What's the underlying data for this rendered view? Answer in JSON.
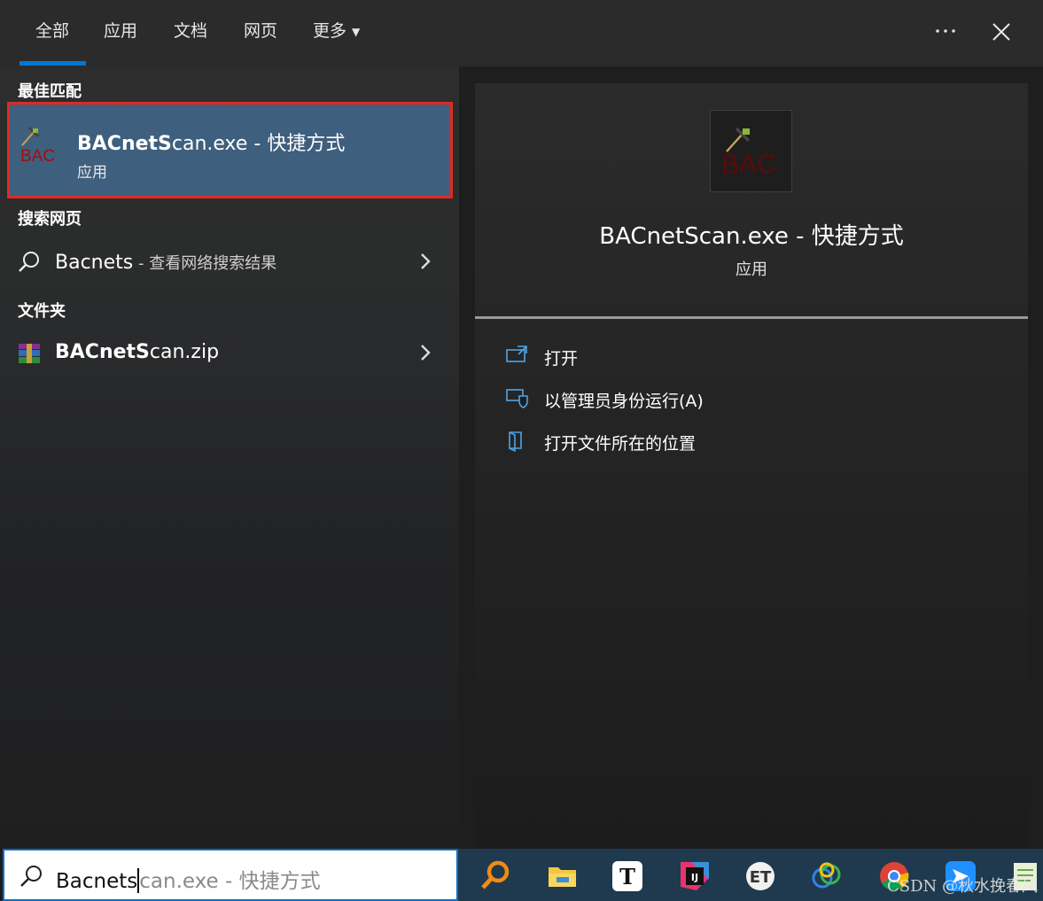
{
  "tabs": [
    {
      "label": "全部",
      "active": true
    },
    {
      "label": "应用"
    },
    {
      "label": "文档"
    },
    {
      "label": "网页"
    },
    {
      "label": "更多"
    }
  ],
  "sections": {
    "best_match": "最佳匹配",
    "search_web": "搜索网页",
    "folders": "文件夹"
  },
  "best_match": {
    "title_bold": "BACnetS",
    "title_rest": "can.exe - 快捷方式",
    "subtitle": "应用",
    "icon_text": "BAC"
  },
  "web_result": {
    "query": "Bacnets",
    "suffix": " - 查看网络搜索结果"
  },
  "folder_result": {
    "bold": "BACnetS",
    "rest": "can.zip"
  },
  "preview": {
    "icon_text": "BAC",
    "title": "BACnetScan.exe - 快捷方式",
    "subtitle": "应用",
    "actions": [
      {
        "label": "打开",
        "icon": "open-window-icon"
      },
      {
        "label": "以管理员身份运行(A)",
        "icon": "admin-shield-icon"
      },
      {
        "label": "打开文件所在的位置",
        "icon": "file-location-icon"
      }
    ]
  },
  "search": {
    "typed": "Bacnets",
    "completion": "can.exe - 快捷方式"
  },
  "taskbar_icons": [
    "everything-search-icon",
    "file-explorer-icon",
    "typora-icon",
    "intellij-idea-icon",
    "et-app-icon",
    "app-rings-icon",
    "chrome-icon",
    "feishu-icon",
    "notepad-icon"
  ],
  "watermark": "CSDN @秋水挽春风",
  "colors": {
    "accent": "#0078d4",
    "highlight": "#3f5f7e",
    "red_box": "#e02a22"
  }
}
